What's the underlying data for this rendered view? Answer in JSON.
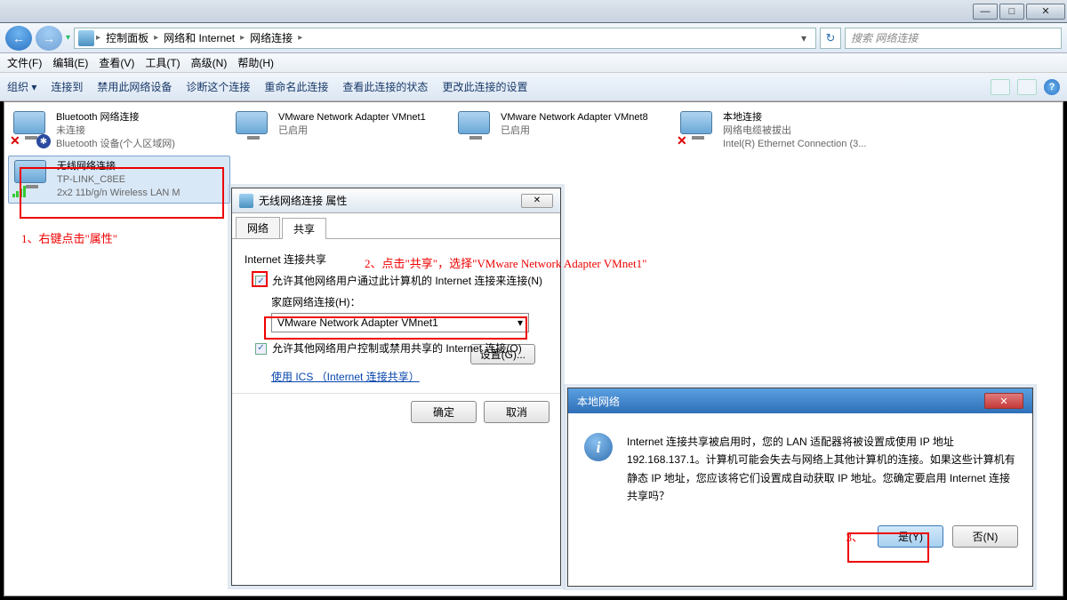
{
  "titlebar": {
    "minimize": "—",
    "maximize": "□",
    "close": "✕"
  },
  "nav": {
    "back": "←",
    "forward": "→",
    "crumbs": [
      "控制面板",
      "网络和 Internet",
      "网络连接"
    ],
    "refresh": "↻",
    "search_placeholder": "搜索 网络连接"
  },
  "menu": [
    "文件(F)",
    "编辑(E)",
    "查看(V)",
    "工具(T)",
    "高级(N)",
    "帮助(H)"
  ],
  "toolbar": {
    "items": [
      "组织 ▾",
      "连接到",
      "禁用此网络设备",
      "诊断这个连接",
      "重命名此连接",
      "查看此连接的状态",
      "更改此连接的设置"
    ],
    "help": "?"
  },
  "connections": [
    {
      "name": "Bluetooth 网络连接",
      "sub1": "未连接",
      "sub2": "Bluetooth 设备(个人区域网)",
      "status": "off",
      "badge_bg": "#2a4aa0",
      "badge_text": "✱"
    },
    {
      "name": "VMware Network Adapter VMnet1",
      "sub1": "",
      "sub2": "已启用",
      "status": "on"
    },
    {
      "name": "VMware Network Adapter VMnet8",
      "sub1": "",
      "sub2": "已启用",
      "status": "on"
    },
    {
      "name": "本地连接",
      "sub1": "网络电缆被拔出",
      "sub2": "Intel(R) Ethernet Connection (3...",
      "status": "off"
    },
    {
      "name": "无线网络连接",
      "sub1": "TP-LINK_C8EE",
      "sub2": "2x2 11b/g/n Wireless LAN M",
      "status": "wifi",
      "selected": true
    }
  ],
  "annotations": {
    "a1": "1、右键点击\"属性\"",
    "a2": "2、点击\"共享\"，选择\"VMware Network Adapter VMnet1\"",
    "a3": "3、"
  },
  "dialog": {
    "title": "无线网络连接 属性",
    "close": "✕",
    "tabs": [
      "网络",
      "共享"
    ],
    "section": "Internet 连接共享",
    "chk1": "允许其他网络用户通过此计算机的 Internet 连接来连接(N)",
    "home_label": "家庭网络连接(H)：",
    "dropdown_value": "VMware Network Adapter VMnet1",
    "dropdown_arrow": "▾",
    "chk2": "允许其他网络用户控制或禁用共享的 Internet 连接(O)",
    "link": "使用 ICS （Internet 连接共享）",
    "settings_btn": "设置(G)...",
    "ok": "确定",
    "cancel": "取消"
  },
  "msgbox": {
    "title": "本地网络",
    "close": "✕",
    "body": "Internet 连接共享被启用时，您的 LAN 适配器将被设置成使用 IP 地址 192.168.137.1。计算机可能会失去与网络上其他计算机的连接。如果这些计算机有静态 IP 地址，您应该将它们设置成自动获取 IP 地址。您确定要启用 Internet 连接共享吗？",
    "yes": "是(Y)",
    "no": "否(N)"
  }
}
